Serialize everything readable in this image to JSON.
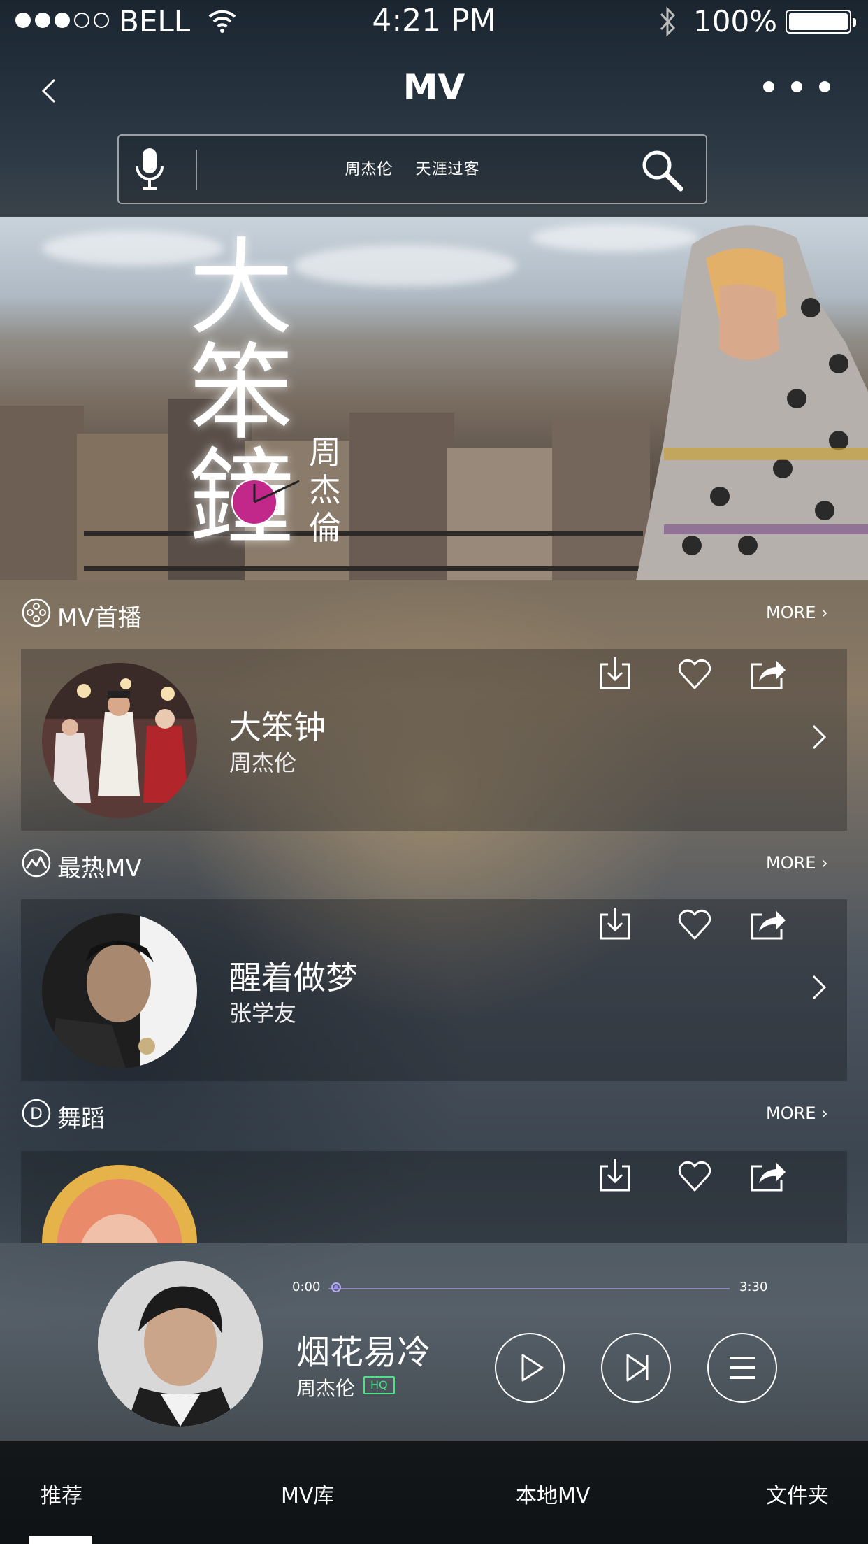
{
  "status_bar": {
    "carrier": "BELL",
    "time": "4:21 PM",
    "battery": "100%",
    "signal_dots": [
      true,
      true,
      true,
      false,
      false
    ]
  },
  "nav": {
    "title": "MV"
  },
  "search": {
    "keywords": [
      "周杰伦",
      "天涯过客"
    ]
  },
  "banner": {
    "title_chars": [
      "大",
      "笨",
      "鐘"
    ],
    "artist_chars": [
      "周",
      "杰",
      "倫"
    ]
  },
  "sections": [
    {
      "title": "MV首播",
      "more": "MORE",
      "item": {
        "title": "大笨钟",
        "artist": "周杰伦"
      }
    },
    {
      "title": "最热MV",
      "more": "MORE",
      "item": {
        "title": "醒着做梦",
        "artist": "张学友"
      }
    },
    {
      "title": "舞蹈",
      "more": "MORE"
    }
  ],
  "player": {
    "current_time": "0:00",
    "total_time": "3:30",
    "progress": 0,
    "title": "烟花易冷",
    "artist": "周杰伦",
    "quality_badge": "HQ"
  },
  "tabs": [
    {
      "label": "推荐",
      "selected": true
    },
    {
      "label": "MV库",
      "selected": false
    },
    {
      "label": "本地MV",
      "selected": false
    },
    {
      "label": "文件夹",
      "selected": false
    }
  ],
  "colors": {
    "progress_accent": "#9d89f5",
    "hq_badge": "#4fe08a"
  }
}
